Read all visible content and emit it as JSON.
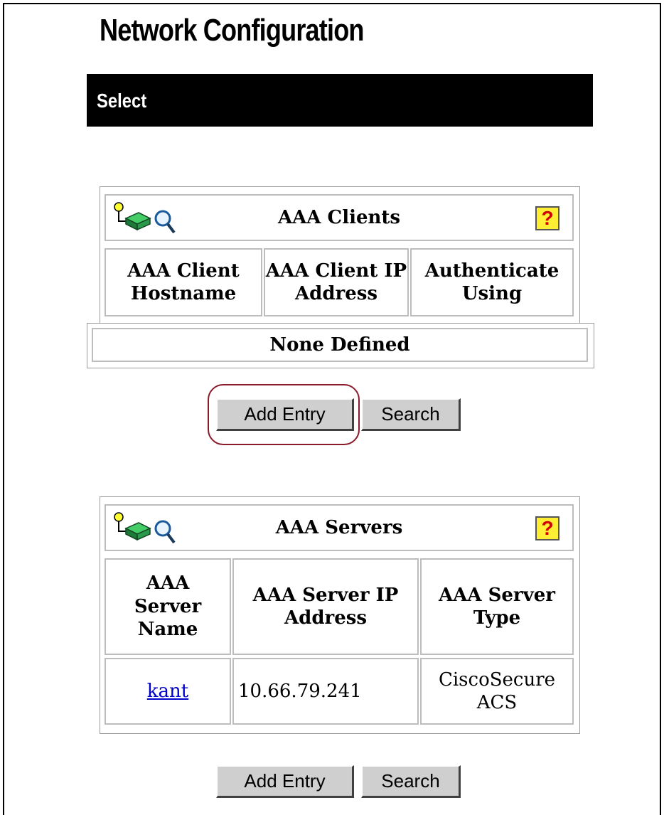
{
  "page": {
    "title": "Network Configuration",
    "section_label": "Select"
  },
  "clients": {
    "title": "AAA Clients",
    "headers": [
      "AAA Client Hostname",
      "AAA Client IP Address",
      "Authenticate Using"
    ],
    "empty_text": "None Defined",
    "add_label": "Add Entry",
    "search_label": "Search"
  },
  "servers": {
    "title": "AAA Servers",
    "headers": [
      "AAA Server Name",
      "AAA Server IP Address",
      "AAA Server Type"
    ],
    "rows": [
      {
        "name": "kant",
        "ip": "10.66.79.241",
        "type": "CiscoSecure ACS"
      }
    ],
    "add_label": "Add Entry",
    "search_label": "Search"
  },
  "icons": {
    "network": "network-device-icon",
    "search": "magnifier-icon",
    "help": "help-icon",
    "help_glyph": "?"
  },
  "colors": {
    "select_bar": "#000000",
    "help_bg": "#ffee33",
    "help_fg": "#d00000",
    "highlight": "#8a1a2a",
    "link": "#0000cc"
  }
}
